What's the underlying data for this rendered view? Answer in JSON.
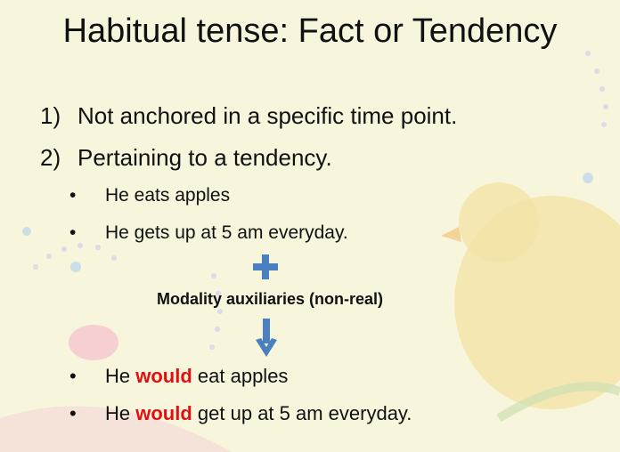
{
  "title": "Habitual tense: Fact or Tendency",
  "numbered": [
    {
      "num": "1)",
      "text": "Not anchored in a specific time point."
    },
    {
      "num": "2)",
      "text": "Pertaining to a tendency."
    }
  ],
  "bullets_top": [
    "He eats apples",
    "He gets up at 5 am everyday."
  ],
  "plus_icon": "plus-icon",
  "modality_label": "Modality auxiliaries (non-real)",
  "arrow_icon": "arrow-down-icon",
  "bullets_bottom": [
    {
      "pre": "He ",
      "modal": "would",
      "post": " eat apples"
    },
    {
      "pre": "He ",
      "modal": "would",
      "post": " get up at 5 am everyday."
    }
  ],
  "colors": {
    "background": "#f7f5dc",
    "accent": "#4a7fc1",
    "highlight": "#e01010"
  }
}
